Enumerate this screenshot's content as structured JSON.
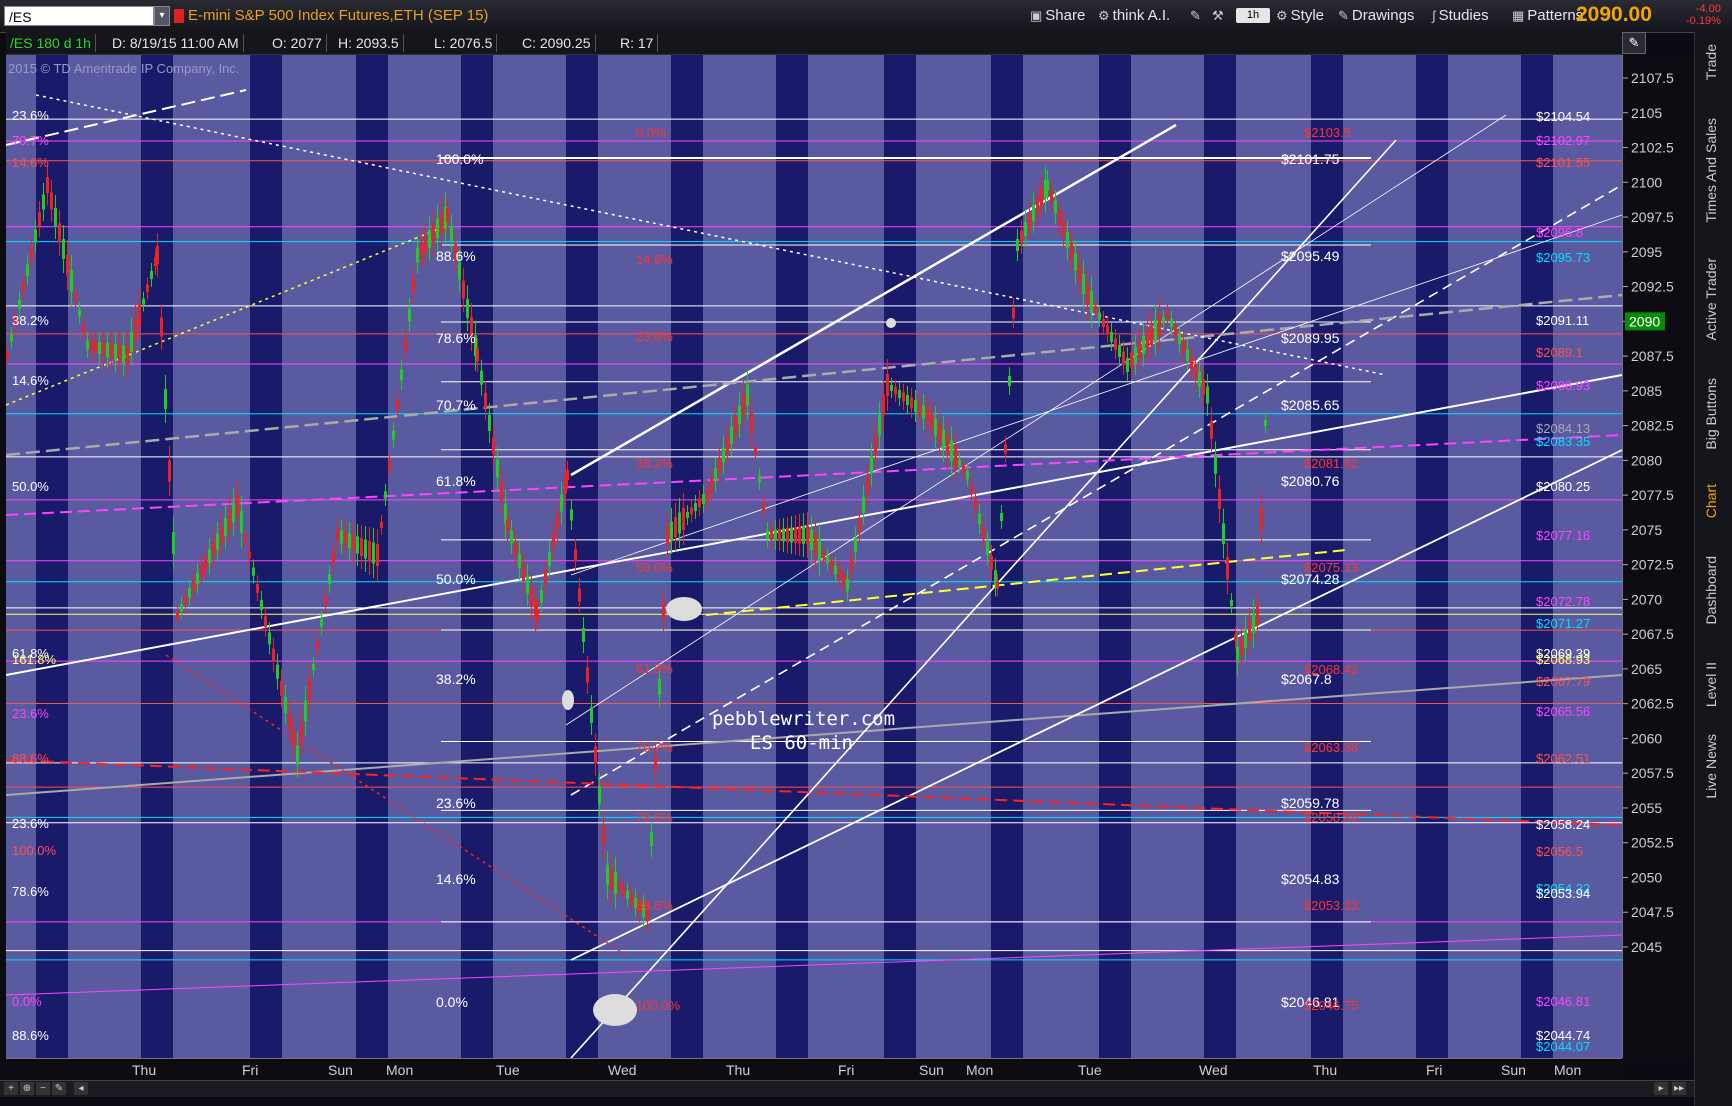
{
  "toolbar": {
    "symbol": "/ES",
    "description": "E-mini S&P 500 Index Futures,ETH (SEP 15)",
    "share_label": "Share",
    "think_ai_label": "think A.I.",
    "interval_label": "1h",
    "style_label": "Style",
    "drawings_label": "Drawings",
    "studies_label": "Studies",
    "patterns_label": "Patterns",
    "last_price": "2090.00",
    "net_change": "-4.00",
    "pct_change": "-0.19%"
  },
  "infobar": {
    "symbol_period": "/ES 180 d 1h",
    "date": "D: 8/19/15 11:00 AM",
    "open": "O: 2077",
    "high": "H: 2093.5",
    "low": "L: 2076.5",
    "close": "C: 2090.25",
    "range": "R: 17"
  },
  "copyright": "2015 © TD Ameritrade IP Company, Inc.",
  "watermark": {
    "line1": "pebblewriter.com",
    "line2": "ES 60-min"
  },
  "price_axis_ticks": [
    "2107.5",
    "2105",
    "2102.5",
    "2100",
    "2097.5",
    "2095",
    "2092.5",
    "2090",
    "2087.5",
    "2085",
    "2082.5",
    "2080",
    "2077.5",
    "2075",
    "2072.5",
    "2070",
    "2067.5",
    "2065",
    "2062.5",
    "2060",
    "2057.5",
    "2055",
    "2052.5",
    "2050",
    "2047.5",
    "2045"
  ],
  "current_price_label": "2090",
  "time_axis_labels": [
    "Thu",
    "Fri",
    "Sun",
    "Mon",
    "Tue",
    "Wed",
    "Thu",
    "Fri",
    "Sun",
    "Mon",
    "Tue",
    "Wed",
    "Thu",
    "Fri",
    "Sun",
    "Mon"
  ],
  "right_tabs": [
    "Trade",
    "Times And Sales",
    "Active Trader",
    "Big Buttons",
    "Chart",
    "Dashboard",
    "Level II",
    "Live News"
  ],
  "active_tab": "Chart",
  "fib_left_labels": [
    {
      "t": "23.6%",
      "c": "#ffffff"
    },
    {
      "t": "70.7%",
      "c": "#ff44ff"
    },
    {
      "t": "14.6%",
      "c": "#ff5050"
    },
    {
      "t": "38.2%",
      "c": "#ffffff"
    },
    {
      "t": "14.6%",
      "c": "#ffffff"
    },
    {
      "t": "50.0%",
      "c": "#ffffff"
    },
    {
      "t": "61.8%",
      "c": "#ffffff"
    },
    {
      "t": "161.8%",
      "c": "#ffff66"
    },
    {
      "t": "23.6%",
      "c": "#ff44ff"
    },
    {
      "t": "88.6%",
      "c": "#ff5050"
    },
    {
      "t": "23.6%",
      "c": "#ffffff"
    },
    {
      "t": "100.0%",
      "c": "#ff5050"
    },
    {
      "t": "78.6%",
      "c": "#ffffff"
    },
    {
      "t": "0.0%",
      "c": "#ff44ff"
    },
    {
      "t": "88.6%",
      "c": "#ffffff"
    }
  ],
  "fib_mid_labels": [
    "100.0%",
    "88.6%",
    "78.6%",
    "70.7%",
    "61.8%",
    "50.0%",
    "38.2%",
    "23.6%",
    "14.6%",
    "0.0%"
  ],
  "fib_mid_red_labels": [
    "0.0%",
    "14.6%",
    "23.6%",
    "38.2%",
    "50.0%",
    "61.8%",
    "70.7%",
    "78.6%",
    "88.6%",
    "100.0%"
  ],
  "mid_price_labels": [
    "$2101.75",
    "$2095.49",
    "$2089.95",
    "$2085.65",
    "$2080.76",
    "$2074.28",
    "$2067.8",
    "$2059.78",
    "$2054.83",
    "$2046.81"
  ],
  "mid_red_price_labels": [
    "$2103.5",
    "$2081.82",
    "$2075.13",
    "$2068.42",
    "$2063.38",
    "$2058.89",
    "$2053.33",
    "$2046.75"
  ],
  "right_price_labels": [
    {
      "t": "$2104.54",
      "c": "#ffffff"
    },
    {
      "t": "$2102.97",
      "c": "#ff44ff"
    },
    {
      "t": "$2101.55",
      "c": "#ff5050"
    },
    {
      "t": "$2096.8",
      "c": "#ff44ff"
    },
    {
      "t": "$2095.73",
      "c": "#00e0ff"
    },
    {
      "t": "$2091.11",
      "c": "#ffffff"
    },
    {
      "t": "$2089.1",
      "c": "#ff5050"
    },
    {
      "t": "$2086.93",
      "c": "#ff44ff"
    },
    {
      "t": "$2084.13",
      "c": "#aaaaaa"
    },
    {
      "t": "$2083.35",
      "c": "#00e0ff"
    },
    {
      "t": "$2080.25",
      "c": "#ffffff"
    },
    {
      "t": "$2077.16",
      "c": "#ff44ff"
    },
    {
      "t": "$2072.78",
      "c": "#ff44ff"
    },
    {
      "t": "$2071.27",
      "c": "#00e0ff"
    },
    {
      "t": "$2069.39",
      "c": "#ffffff"
    },
    {
      "t": "$2068.93",
      "c": "#ffff66"
    },
    {
      "t": "$2067.79",
      "c": "#ff5050"
    },
    {
      "t": "$2065.56",
      "c": "#ff44ff"
    },
    {
      "t": "$2062.51",
      "c": "#ff5050"
    },
    {
      "t": "$2058.24",
      "c": "#ffffff"
    },
    {
      "t": "$2056.5",
      "c": "#ff5050"
    },
    {
      "t": "$2054.32",
      "c": "#00e0ff"
    },
    {
      "t": "$2053.94",
      "c": "#ffffff"
    },
    {
      "t": "$2046.81",
      "c": "#ff44ff"
    },
    {
      "t": "$2044.74",
      "c": "#ffffff"
    },
    {
      "t": "$2044.07",
      "c": "#00e0ff"
    }
  ],
  "colors": {
    "bg_band_dark": "#1a1a6a",
    "bg_band_light": "#5a5aa0",
    "up_candle": "#22cc22",
    "down_candle": "#ee2222",
    "accent": "#f0a800"
  }
}
